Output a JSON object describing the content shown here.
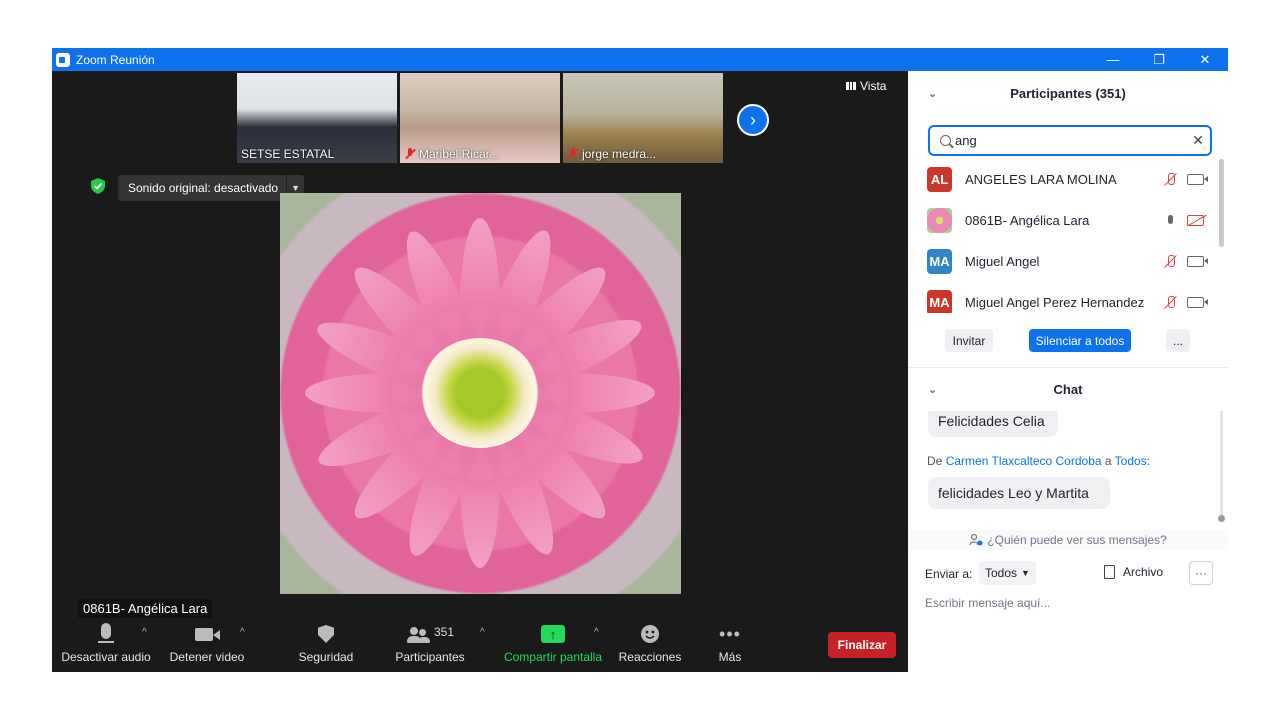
{
  "window": {
    "title": "Zoom Reunión",
    "controls": [
      "—",
      "❐",
      "✕"
    ],
    "accent": "#0e72ed"
  },
  "gallery": {
    "thumbs": [
      {
        "name": "SETSE ESTATAL",
        "muted": false
      },
      {
        "name": "Maribel Ricar...",
        "muted": true
      },
      {
        "name": "jorge medra...",
        "muted": true
      }
    ],
    "next_icon": "chevron-right-icon"
  },
  "view_button": {
    "label": "Vista"
  },
  "sound_status": {
    "label": "Sonido original: desactivado"
  },
  "main_video": {
    "speaker": "0861B- Angélica Lara"
  },
  "toolbar": {
    "audio_label": "Desactivar audio",
    "video_label": "Detener video",
    "security_label": "Seguridad",
    "participants_label": "Participantes",
    "participants_count": "351",
    "share_label": "Compartir pantalla",
    "reactions_label": "Reacciones",
    "more_label": "Más",
    "end_label": "Finalizar",
    "end_color": "#c62127",
    "share_color": "#23d959"
  },
  "participants": {
    "header": "Participantes (351)",
    "search_value": "ang",
    "items": [
      {
        "initials": "AL",
        "name": "ANGELES LARA MOLINA",
        "avatar_color": "#c9392b",
        "mic": "off",
        "cam": "on"
      },
      {
        "initials": "",
        "name": "0861B- Angélica Lara",
        "avatar_color": "#e07aa8",
        "mic": "on",
        "cam": "off"
      },
      {
        "initials": "MA",
        "name": "Miguel Angel",
        "avatar_color": "#2f86c7",
        "mic": "off",
        "cam": "on"
      },
      {
        "initials": "MA",
        "name": "Miguel Angel Perez Hernandez",
        "avatar_color": "#c9392b",
        "mic": "off",
        "cam": "on"
      }
    ],
    "invite_label": "Invitar",
    "mute_all_label": "Silenciar a todos",
    "more_label": "..."
  },
  "chat": {
    "header": "Chat",
    "messages": [
      {
        "text": "Felicidades Celia"
      },
      {
        "prefix": "De ",
        "from": "Carmen Tlaxcalteco Cordoba",
        "mid": " a ",
        "to": "Todos",
        "suffix": ":",
        "text": "felicidades Leo y Martita"
      }
    ],
    "who_sees": "¿Quién puede ver sus mensajes?",
    "send_to_label": "Enviar a:",
    "send_to_value": "Todos",
    "file_label": "Archivo",
    "more_label": "···",
    "input_placeholder": "Escribir mensaje aquí..."
  }
}
